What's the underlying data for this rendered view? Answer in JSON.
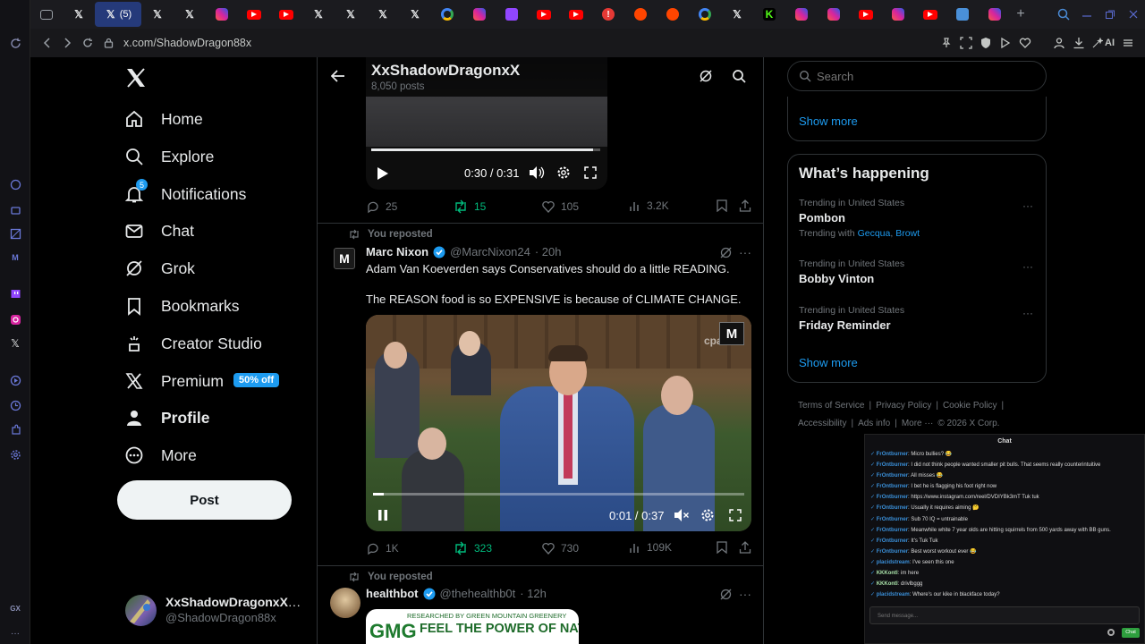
{
  "browser": {
    "active_tab_label": "(5)",
    "url": "x.com/ShadowDragon88x",
    "ai_label": "AI",
    "tabs": [
      {
        "icon": "mail-icon",
        "color": "#9aa0a6"
      },
      {
        "icon": "x-icon",
        "color": "#e7e9ea"
      },
      {
        "icon": "x-icon",
        "color": "#e7e9ea",
        "active": true
      },
      {
        "icon": "x-icon",
        "color": "#e7e9ea"
      },
      {
        "icon": "x-icon",
        "color": "#e7e9ea"
      },
      {
        "icon": "instagram-icon",
        "color": "#d6249f"
      },
      {
        "icon": "youtube-icon",
        "color": "#ff0000"
      },
      {
        "icon": "youtube-icon",
        "color": "#ff0000"
      },
      {
        "icon": "x-icon",
        "color": "#e7e9ea"
      },
      {
        "icon": "x-icon",
        "color": "#e7e9ea"
      },
      {
        "icon": "x-icon",
        "color": "#e7e9ea"
      },
      {
        "icon": "x-icon",
        "color": "#e7e9ea"
      },
      {
        "icon": "google-icon",
        "color": "#4285f4"
      },
      {
        "icon": "instagram-icon",
        "color": "#d6249f"
      },
      {
        "icon": "twitch-icon",
        "color": "#9146ff"
      },
      {
        "icon": "youtube-icon",
        "color": "#ff0000"
      },
      {
        "icon": "youtube-icon",
        "color": "#ff0000"
      },
      {
        "icon": "alert-icon",
        "color": "#e53935"
      },
      {
        "icon": "reddit-icon",
        "color": "#ff4500"
      },
      {
        "icon": "reddit-icon",
        "color": "#ff4500"
      },
      {
        "icon": "google-icon",
        "color": "#4285f4"
      },
      {
        "icon": "x-icon",
        "color": "#e7e9ea"
      },
      {
        "icon": "kick-icon",
        "color": "#53fc18"
      },
      {
        "icon": "instagram-icon",
        "color": "#d6249f"
      },
      {
        "icon": "instagram-icon",
        "color": "#d6249f"
      },
      {
        "icon": "youtube-icon",
        "color": "#ff0000"
      },
      {
        "icon": "instagram-icon",
        "color": "#d6249f"
      },
      {
        "icon": "youtube-icon",
        "color": "#ff0000"
      },
      {
        "icon": "app-icon",
        "color": "#4a90d9"
      },
      {
        "icon": "instagram-icon",
        "color": "#d6249f"
      }
    ]
  },
  "nav": {
    "items": [
      {
        "label": "Home",
        "icon": "home-icon"
      },
      {
        "label": "Explore",
        "icon": "search-icon"
      },
      {
        "label": "Notifications",
        "icon": "bell-icon",
        "badge": "5"
      },
      {
        "label": "Chat",
        "icon": "mail-icon"
      },
      {
        "label": "Grok",
        "icon": "grok-icon"
      },
      {
        "label": "Bookmarks",
        "icon": "bookmark-icon"
      },
      {
        "label": "Creator Studio",
        "icon": "creator-icon"
      },
      {
        "label": "Premium",
        "icon": "x-icon",
        "badge": "50% off"
      },
      {
        "label": "Profile",
        "icon": "person-icon"
      },
      {
        "label": "More",
        "icon": "more-circle-icon"
      }
    ],
    "post_button": "Post",
    "account": {
      "name": "XxShadowDragonxX",
      "handle": "@ShadowDragon88x"
    }
  },
  "header": {
    "title": "XxShadowDragonxX",
    "subtitle": "8,050 posts"
  },
  "post0": {
    "video_time": "0:30 / 0:31",
    "progress": 0.97,
    "replies": "25",
    "reposts": "15",
    "likes": "105",
    "views": "3.2K"
  },
  "post1": {
    "reposted_label": "You reposted",
    "name": "Marc Nixon",
    "handle": "@MarcNixon24",
    "time": "· 20h",
    "avatar_letter": "M",
    "text1": "Adam Van Koeverden says Conservatives should do a little READING.",
    "text2": "The REASON food is so EXPENSIVE is because of CLIMATE CHANGE.",
    "video_time": "0:01 / 0:37",
    "progress": 0.03,
    "watermark": "cpac",
    "replies": "1K",
    "reposts": "323",
    "likes": "730",
    "views": "109K"
  },
  "post2": {
    "reposted_label": "You reposted",
    "name": "healthbot",
    "handle": "@thehealthb0t",
    "time": "· 12h",
    "media_line1": "RESEARCHED BY GREEN MOUNTAIN GREENERY",
    "media_line2": "FEEL THE POWER OF NATURE",
    "media_logo": "GMG"
  },
  "right": {
    "search_placeholder": "Search",
    "show_more": "Show more",
    "whats_happening_title": "What’s happening",
    "trends": [
      {
        "context": "Trending in United States",
        "title": "Pombon",
        "with_label": "Trending with",
        "with1": "Gecqua",
        "with2": "Browt"
      },
      {
        "context": "Trending in United States",
        "title": "Bobby Vinton"
      },
      {
        "context": "Trending in United States",
        "title": "Friday Reminder"
      }
    ],
    "show_more2": "Show more",
    "footer": {
      "tos": "Terms of Service",
      "privacy": "Privacy Policy",
      "cookie": "Cookie Policy",
      "accessibility": "Accessibility",
      "ads": "Ads info",
      "more": "More ···",
      "copyright": "© 2026 X Corp."
    }
  },
  "chat": {
    "title": "Chat",
    "messages": [
      {
        "user": "FrOntburner",
        "text": "Micro bullies? 😂",
        "style": "u"
      },
      {
        "user": "FrOntburner",
        "text": "I did not think people wanted smaller pit bulls. That seems really counterintuitive",
        "style": "u"
      },
      {
        "user": "FrOntburner",
        "text": "All misses 😂",
        "style": "u"
      },
      {
        "user": "FrOntburner",
        "text": "I bet he is flagging his foot right now",
        "style": "u"
      },
      {
        "user": "FrOntburner",
        "text": "https://www.instagram.com/reel/DVDIYBk3mT Tuk tuk",
        "style": "u"
      },
      {
        "user": "FrOntburner",
        "text": "Usually it requires aiming 🤔",
        "style": "u"
      },
      {
        "user": "FrOntburner",
        "text": "Sub 70 IQ = untrainable",
        "style": "u"
      },
      {
        "user": "FrOntburner",
        "text": "Meanwhile white 7 year olds are hitting squirrels from 500 yards away with BB guns.",
        "style": "u"
      },
      {
        "user": "FrOntburner",
        "text": "It's Tuk Tuk",
        "style": "u"
      },
      {
        "user": "FrOntburner",
        "text": "Best worst workout ever 😂",
        "style": "u"
      },
      {
        "user": "placidstream",
        "text": "I've seen this one",
        "style": "u"
      },
      {
        "user": "KKKontl",
        "text": "im here",
        "style": "u2"
      },
      {
        "user": "KKKontl",
        "text": "drivlbggg",
        "style": "u2"
      },
      {
        "user": "placidstream",
        "text": "Where's our kike in blackface today?",
        "style": "u"
      }
    ],
    "input_placeholder": "Send message...",
    "send_label": "Chat"
  },
  "gx": {
    "label": "GX"
  },
  "colors": {
    "accent": "#1d9bf0",
    "repost": "#00ba7c",
    "muted": "#71767b",
    "premium_badge": "#1d9bf0"
  }
}
